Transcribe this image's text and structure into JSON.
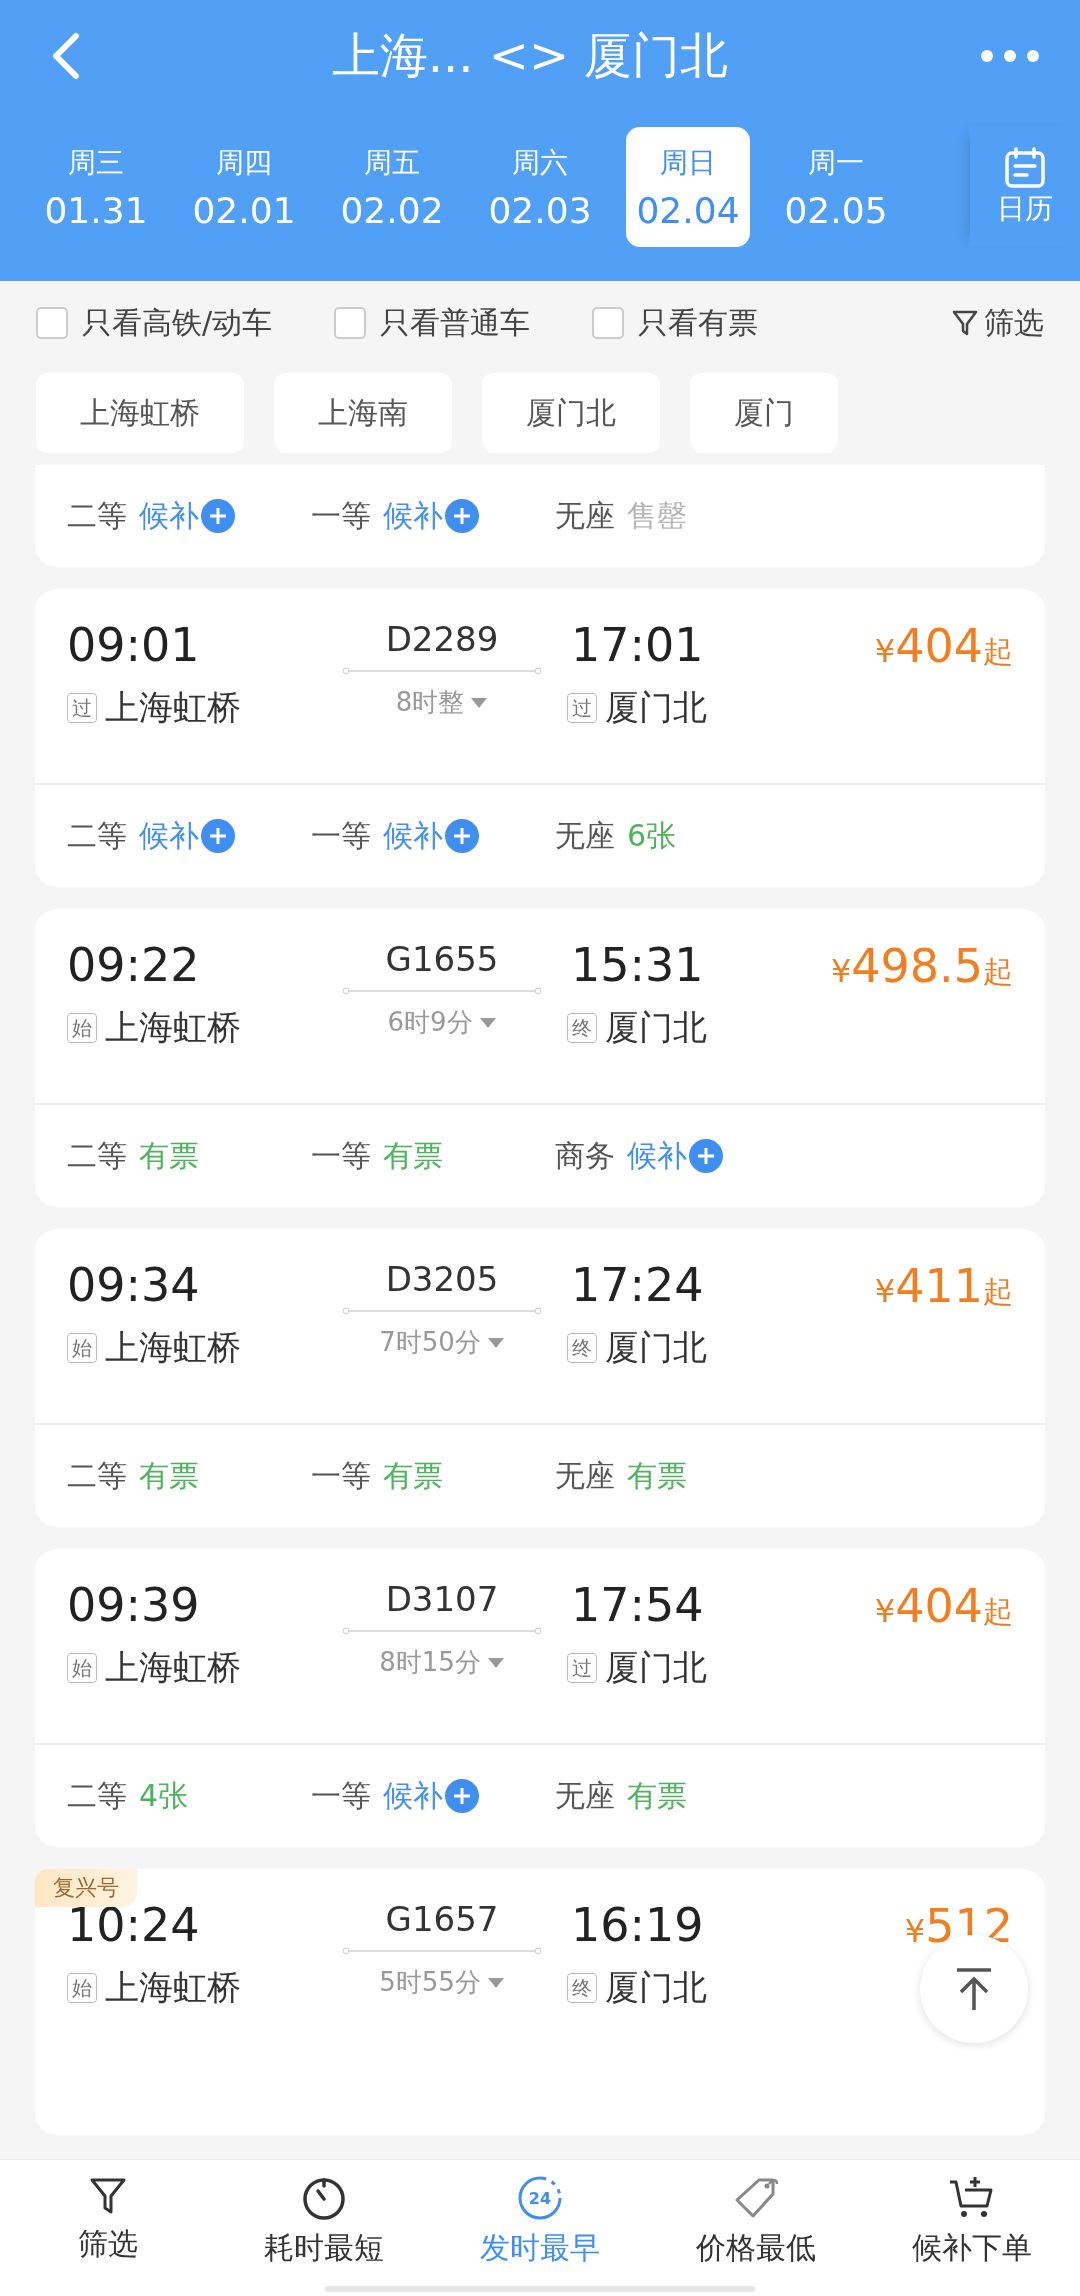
{
  "header": {
    "title": "上海... <> 厦门北"
  },
  "dates": [
    {
      "weekday": "周三",
      "date": "01.31",
      "selected": false
    },
    {
      "weekday": "周四",
      "date": "02.01",
      "selected": false
    },
    {
      "weekday": "周五",
      "date": "02.02",
      "selected": false
    },
    {
      "weekday": "周六",
      "date": "02.03",
      "selected": false
    },
    {
      "weekday": "周日",
      "date": "02.04",
      "selected": true
    },
    {
      "weekday": "周一",
      "date": "02.05",
      "selected": false
    }
  ],
  "calendar_button": {
    "label": "日历"
  },
  "filters": [
    {
      "label": "只看高铁/动车",
      "checked": false
    },
    {
      "label": "只看普通车",
      "checked": false
    },
    {
      "label": "只看有票",
      "checked": false
    }
  ],
  "filter_button": {
    "label": "筛选"
  },
  "stations": [
    "上海虹桥",
    "上海南",
    "厦门北",
    "厦门"
  ],
  "trains": [
    {
      "seats": [
        {
          "class": "二等",
          "status": "候补",
          "kind": "waitlist"
        },
        {
          "class": "一等",
          "status": "候补",
          "kind": "waitlist"
        },
        {
          "class": "无座",
          "status": "售罄",
          "kind": "soldout"
        }
      ]
    },
    {
      "depart": "09:01",
      "from_tag": "过",
      "from": "上海虹桥",
      "number": "D2289",
      "duration": "8时整",
      "arrive": "17:01",
      "to_tag": "过",
      "to": "厦门北",
      "price": {
        "currency": "¥",
        "amount": "404",
        "suffix": "起"
      },
      "seats": [
        {
          "class": "二等",
          "status": "候补",
          "kind": "waitlist"
        },
        {
          "class": "一等",
          "status": "候补",
          "kind": "waitlist"
        },
        {
          "class": "无座",
          "status": "6张",
          "kind": "available"
        }
      ]
    },
    {
      "depart": "09:22",
      "from_tag": "始",
      "from": "上海虹桥",
      "number": "G1655",
      "duration": "6时9分",
      "arrive": "15:31",
      "to_tag": "终",
      "to": "厦门北",
      "price": {
        "currency": "¥",
        "amount": "498.5",
        "suffix": "起"
      },
      "seats": [
        {
          "class": "二等",
          "status": "有票",
          "kind": "available"
        },
        {
          "class": "一等",
          "status": "有票",
          "kind": "available"
        },
        {
          "class": "商务",
          "status": "候补",
          "kind": "waitlist"
        }
      ]
    },
    {
      "depart": "09:34",
      "from_tag": "始",
      "from": "上海虹桥",
      "number": "D3205",
      "duration": "7时50分",
      "arrive": "17:24",
      "to_tag": "终",
      "to": "厦门北",
      "price": {
        "currency": "¥",
        "amount": "411",
        "suffix": "起"
      },
      "seats": [
        {
          "class": "二等",
          "status": "有票",
          "kind": "available"
        },
        {
          "class": "一等",
          "status": "有票",
          "kind": "available"
        },
        {
          "class": "无座",
          "status": "有票",
          "kind": "available"
        }
      ]
    },
    {
      "depart": "09:39",
      "from_tag": "始",
      "from": "上海虹桥",
      "number": "D3107",
      "duration": "8时15分",
      "arrive": "17:54",
      "to_tag": "过",
      "to": "厦门北",
      "price": {
        "currency": "¥",
        "amount": "404",
        "suffix": "起"
      },
      "seats": [
        {
          "class": "二等",
          "status": "4张",
          "kind": "available"
        },
        {
          "class": "一等",
          "status": "候补",
          "kind": "waitlist"
        },
        {
          "class": "无座",
          "status": "有票",
          "kind": "available"
        }
      ]
    },
    {
      "tag": "复兴号",
      "depart": "10:24",
      "from_tag": "始",
      "from": "上海虹桥",
      "number": "G1657",
      "duration": "5时55分",
      "arrive": "16:19",
      "to_tag": "终",
      "to": "厦门北",
      "price": {
        "currency": "¥",
        "amount": "512"
      }
    }
  ],
  "bottom_nav": [
    {
      "label": "筛选",
      "selected": false
    },
    {
      "label": "耗时最短",
      "selected": false
    },
    {
      "label": "发时最早",
      "selected": true,
      "icon_text": "24"
    },
    {
      "label": "价格最低",
      "selected": false
    },
    {
      "label": "候补下单",
      "selected": false
    }
  ]
}
